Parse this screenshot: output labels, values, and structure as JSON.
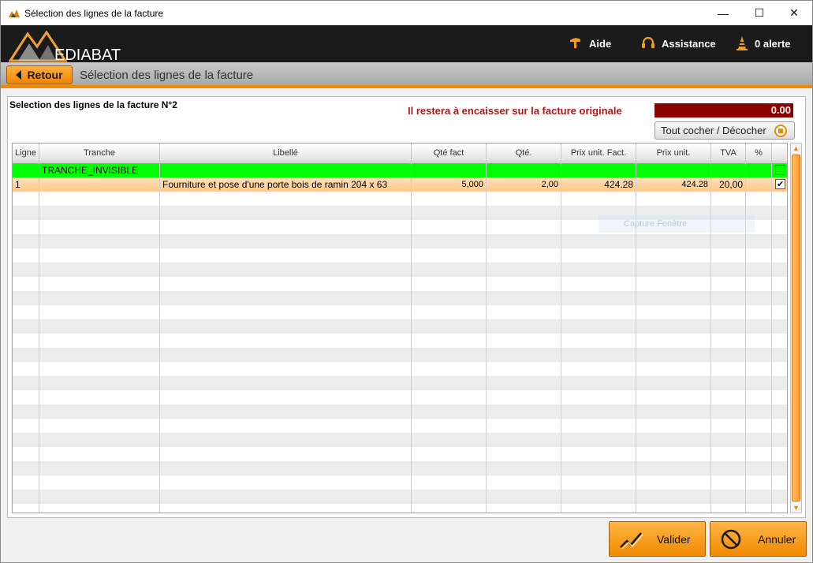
{
  "window": {
    "title": "Sélection des lignes de la facture",
    "controls": {
      "minimize": "—",
      "maximize": "☐",
      "close": "✕"
    }
  },
  "header": {
    "logo_text": "EDIABAT",
    "aide": "Aide",
    "assistance": "Assistance",
    "alerts": "0 alerte"
  },
  "subbar": {
    "back_label": "Retour",
    "title": "Sélection des lignes de la facture"
  },
  "panel": {
    "invoice_title": "Selection des lignes de la facture N°2",
    "remaining_label": "Il restera à encaisser sur la facture originale",
    "remaining_value": "0.00",
    "toggle_label": "Tout cocher / Décocher"
  },
  "grid": {
    "columns": [
      "Ligne",
      "Tranche",
      "Libellé",
      "Qté fact",
      "Qté.",
      "Prix unit. Fact.",
      "Prix unit.",
      "TVA",
      "%",
      ""
    ],
    "rows": [
      {
        "ligne": "",
        "tranche": "TRANCHE_INVISIBLE",
        "libelle": "",
        "qte_fact": "",
        "qte": "",
        "prix_fact": "",
        "prix_unit": "",
        "tva": "",
        "pct": "",
        "checked": false
      },
      {
        "ligne": "1",
        "tranche": "",
        "libelle": "Fourniture et pose d'une porte bois de ramin 204 x 63",
        "qte_fact": "5,000",
        "qte": "2,00",
        "prix_fact": "424.28",
        "prix_unit": "424.28",
        "tva": "20,00",
        "pct": "",
        "checked": true
      }
    ],
    "ghost_tooltip": "Capture Fenêtre"
  },
  "footer": {
    "validate_label": "Valider",
    "cancel_label": "Annuler"
  },
  "colors": {
    "accent": "#f08a00",
    "remaining_bg": "#8b0000",
    "remaining_text": "#b01515",
    "green_row": "#00ff00",
    "header_bg": "#1b1b1b"
  }
}
